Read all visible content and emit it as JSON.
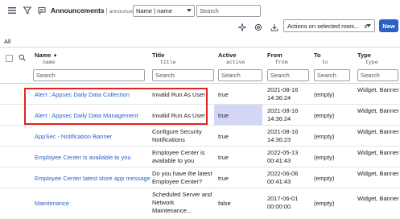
{
  "header": {
    "title": "Announcements",
    "table_name": "announcement",
    "field_select": "Name | name",
    "search_placeholder": "Search"
  },
  "toolbar": {
    "actions_label": "Actions on selected rows...   x",
    "new_label": "New"
  },
  "breadcrumb": "All",
  "columns": [
    {
      "label": "Name",
      "field": "name",
      "sorted": "asc"
    },
    {
      "label": "Title",
      "field": "title"
    },
    {
      "label": "Active",
      "field": "active"
    },
    {
      "label": "From",
      "field": "from"
    },
    {
      "label": "To",
      "field": "to"
    },
    {
      "label": "Type",
      "field": "type"
    }
  ],
  "filter_placeholder": "Search",
  "rows": [
    {
      "name": "Alert : Appsec Daily Data Collection",
      "title": "Invalid Run As User",
      "active": "true",
      "from": "2021-08-16 14:36:24",
      "to": "(empty)",
      "type": "Widget, Banner"
    },
    {
      "name": "Alert : Appsec Daily Data Management",
      "title": "Invalid Run As User",
      "active": "true",
      "from": "2021-08-16 14:36:24",
      "to": "(empty)",
      "type": "Widget, Banner"
    },
    {
      "name": "AppSec - Notification Banner",
      "title": "Configure Security Notifications",
      "active": "true",
      "from": "2021-08-16 14:36:23",
      "to": "(empty)",
      "type": "Widget, Banner"
    },
    {
      "name": "Employee Center is available to you",
      "title": "Employee Center is available to you",
      "active": "true",
      "from": "2022-05-13 00:41:43",
      "to": "(empty)",
      "type": "Widget, Banner"
    },
    {
      "name": "Employee Center latest store app message",
      "title": "Do you have the latest Employee Center?",
      "active": "true",
      "from": "2022-06-06 00:41:43",
      "to": "(empty)",
      "type": "Widget, Banner"
    },
    {
      "name": "Maintenance",
      "title": "Scheduled Server and Network Maintenance...",
      "active": "false",
      "from": "2017-06-01 00:00:00",
      "to": "(empty)",
      "type": "Widget, Banner"
    }
  ],
  "colors": {
    "link": "#2b60c7",
    "primary_button": "#2b60c7",
    "highlight_box": "#e02424",
    "active_cell_highlight": "#d4d6f5"
  }
}
